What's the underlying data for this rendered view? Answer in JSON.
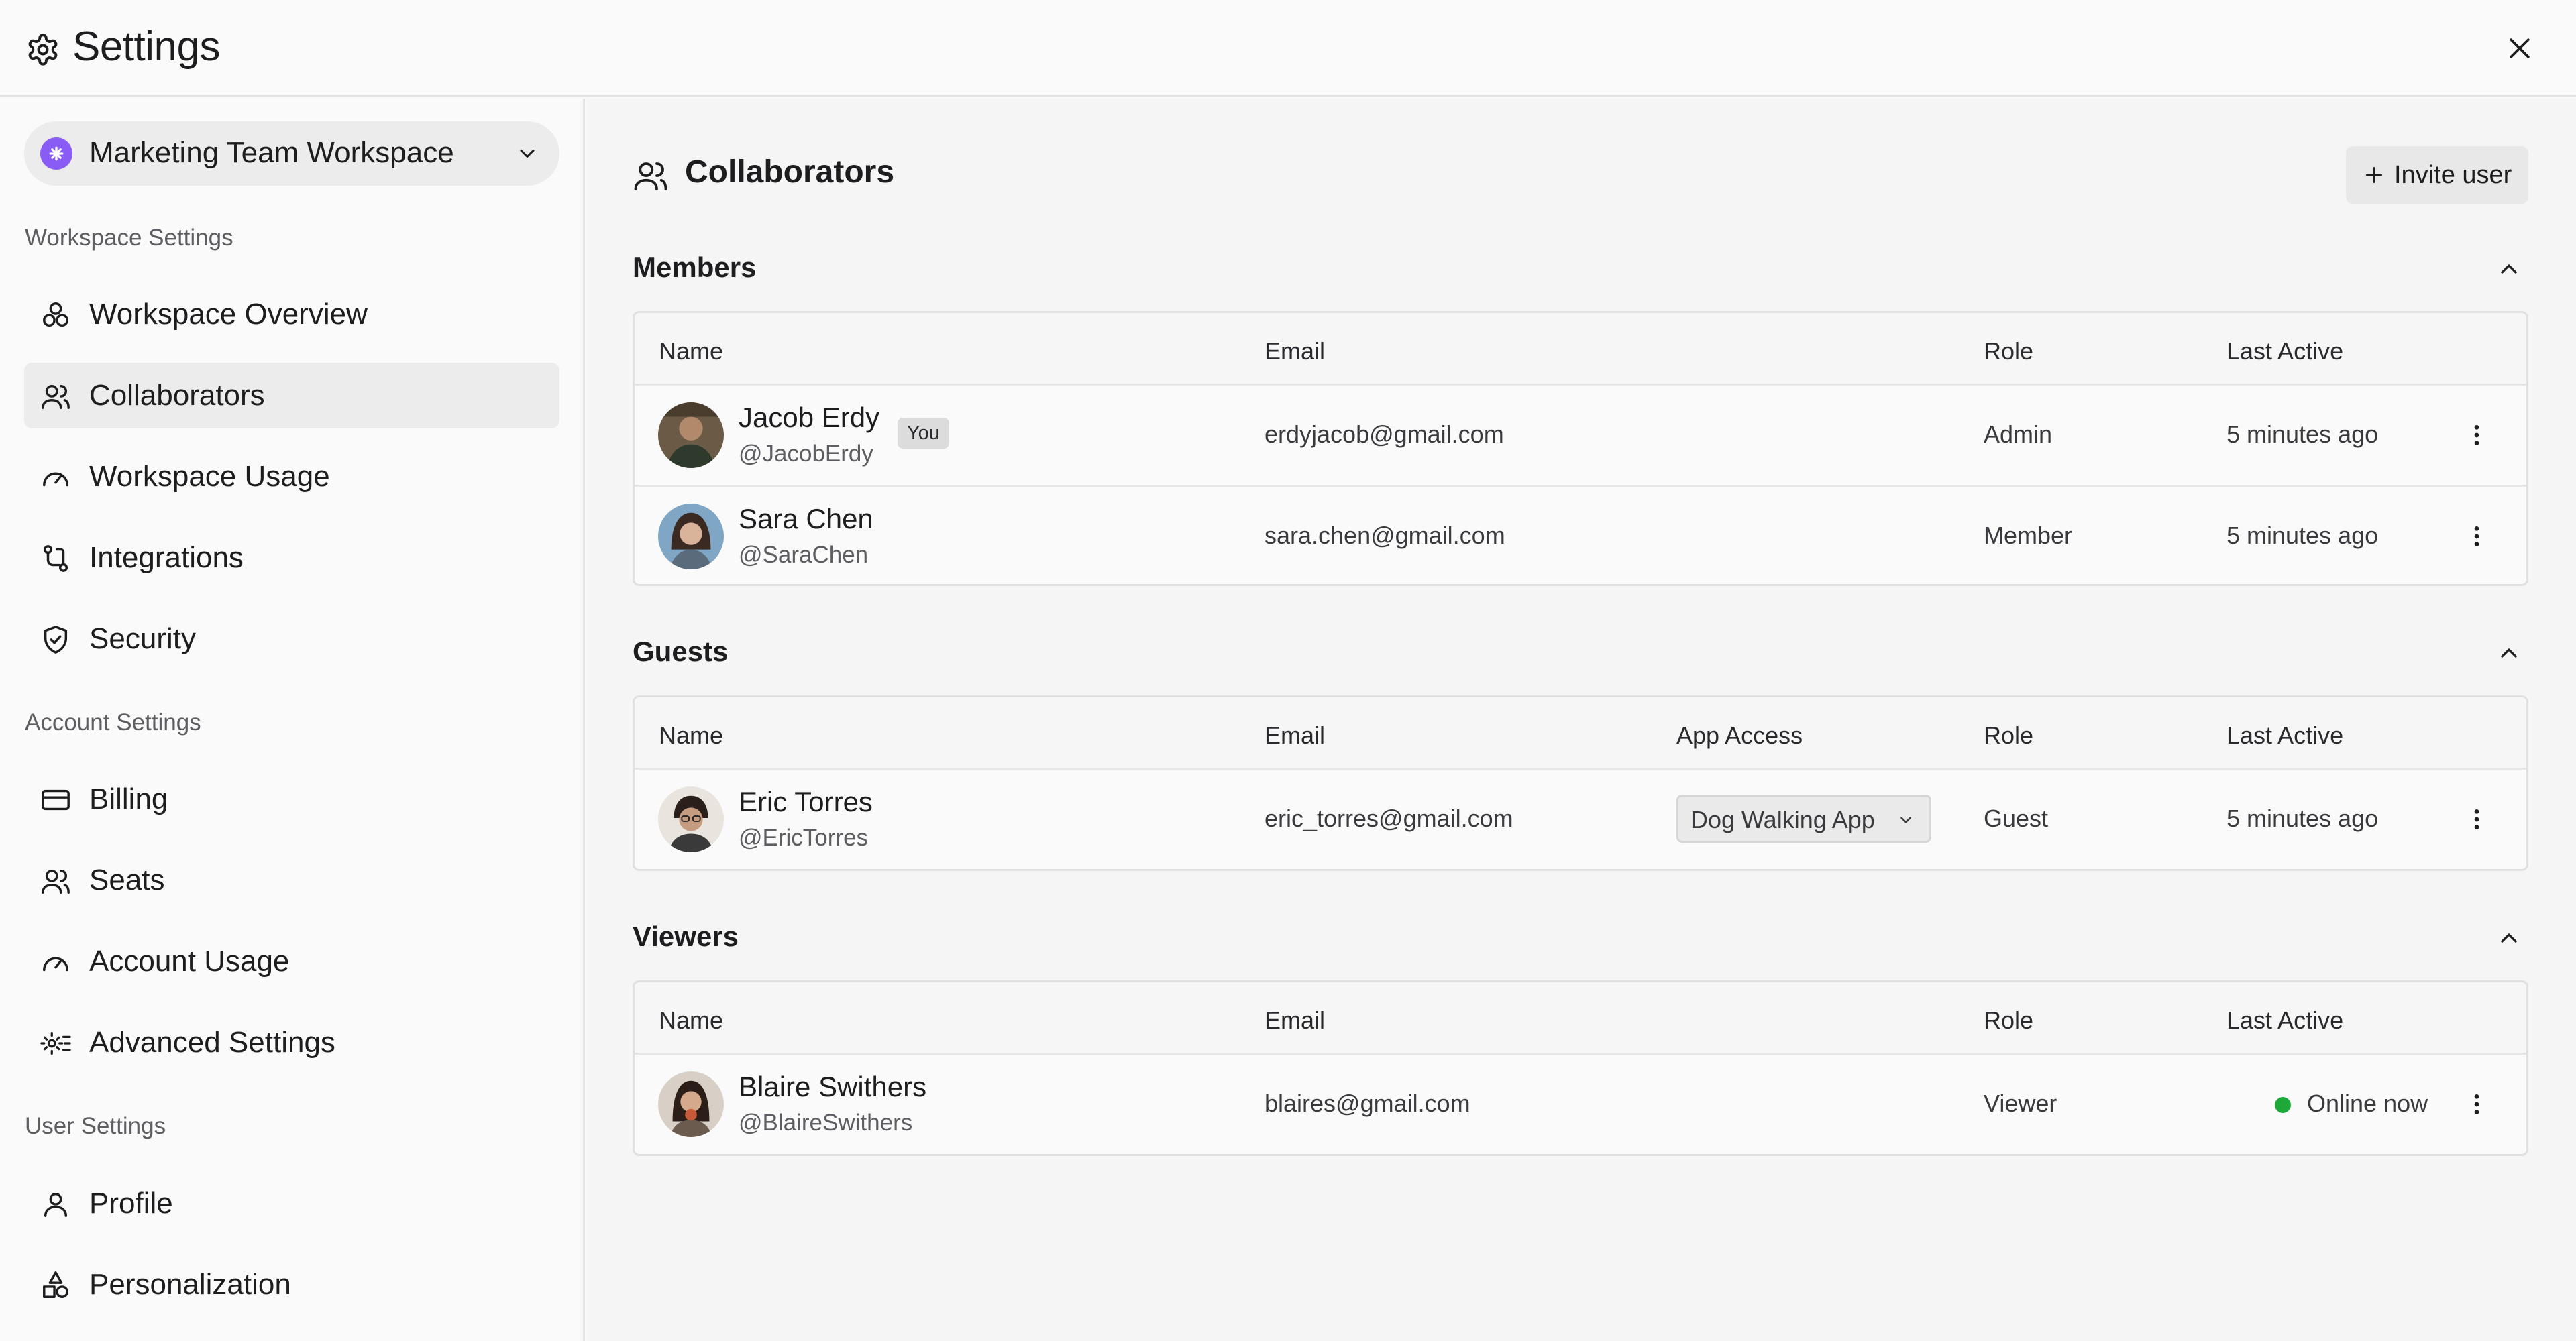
{
  "header": {
    "title": "Settings"
  },
  "sidebar": {
    "workspace": {
      "name": "Marketing Team Workspace"
    },
    "sections": [
      {
        "label": "Workspace Settings",
        "items": [
          {
            "label": "Workspace Overview",
            "icon": "overview-icon"
          },
          {
            "label": "Collaborators",
            "icon": "users-icon",
            "active": true
          },
          {
            "label": "Workspace Usage",
            "icon": "gauge-icon"
          },
          {
            "label": "Integrations",
            "icon": "integrations-icon"
          },
          {
            "label": "Security",
            "icon": "shield-icon"
          }
        ]
      },
      {
        "label": "Account Settings",
        "items": [
          {
            "label": "Billing",
            "icon": "credit-card-icon"
          },
          {
            "label": "Seats",
            "icon": "users-icon"
          },
          {
            "label": "Account Usage",
            "icon": "gauge-icon"
          },
          {
            "label": "Advanced Settings",
            "icon": "gear-list-icon"
          }
        ]
      },
      {
        "label": "User Settings",
        "items": [
          {
            "label": "Profile",
            "icon": "user-icon"
          },
          {
            "label": "Personalization",
            "icon": "shapes-icon"
          }
        ]
      }
    ]
  },
  "main": {
    "title": "Collaborators",
    "invite_label": "Invite user",
    "groups": {
      "members": {
        "title": "Members",
        "columns": [
          "Name",
          "Email",
          "Role",
          "Last Active"
        ],
        "rows": [
          {
            "name": "Jacob Erdy",
            "handle": "@JacobErdy",
            "badge": "You",
            "email": "erdyjacob@gmail.com",
            "role": "Admin",
            "last_active": "5 minutes ago"
          },
          {
            "name": "Sara Chen",
            "handle": "@SaraChen",
            "email": "sara.chen@gmail.com",
            "role": "Member",
            "last_active": "5 minutes ago"
          }
        ]
      },
      "guests": {
        "title": "Guests",
        "columns": [
          "Name",
          "Email",
          "App Access",
          "Role",
          "Last Active"
        ],
        "rows": [
          {
            "name": "Eric Torres",
            "handle": "@EricTorres",
            "email": "eric_torres@gmail.com",
            "app_access": "Dog Walking App",
            "role": "Guest",
            "last_active": "5 minutes ago"
          }
        ]
      },
      "viewers": {
        "title": "Viewers",
        "columns": [
          "Name",
          "Email",
          "Role",
          "Last Active"
        ],
        "rows": [
          {
            "name": "Blaire Swithers",
            "handle": "@BlaireSwithers",
            "email": "blaires@gmail.com",
            "role": "Viewer",
            "last_active": "Online now",
            "online": true
          }
        ]
      }
    }
  },
  "colors": {
    "accent": "#8a5cf6",
    "online": "#1fa83a",
    "border": "#dfe0df"
  }
}
